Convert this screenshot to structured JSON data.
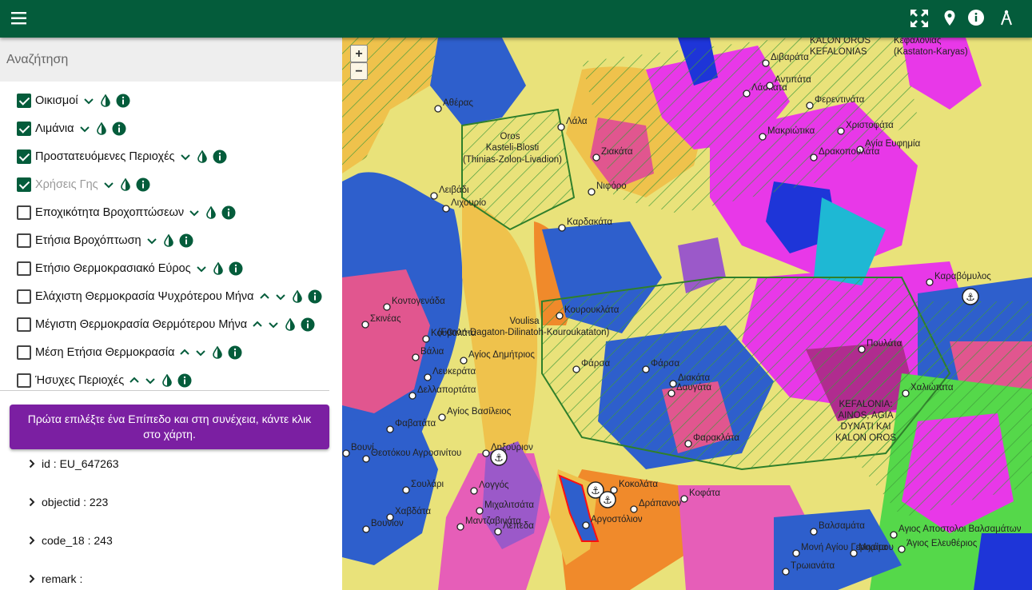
{
  "search": {
    "placeholder": "Αναζήτηση"
  },
  "layers": [
    {
      "label": "Οικισμοί",
      "checked": true,
      "chevrons": "down"
    },
    {
      "label": "Λιμάνια",
      "checked": true,
      "chevrons": "down"
    },
    {
      "label": "Προστατευόμενες Περιοχές",
      "checked": true,
      "chevrons": "down"
    },
    {
      "label": "Χρήσεις Γης",
      "checked": true,
      "chevrons": "down"
    },
    {
      "label": "Εποχικότητα Βροχοπτώσεων",
      "checked": false,
      "chevrons": "down"
    },
    {
      "label": "Ετήσια Βροχόπτωση",
      "checked": false,
      "chevrons": "down"
    },
    {
      "label": "Ετήσιο Θερμοκρασιακό Εύρος",
      "checked": false,
      "chevrons": "down"
    },
    {
      "label": "Ελάχιστη Θερμοκρασία Ψυχρότερου Μήνα",
      "checked": false,
      "chevrons": "updown"
    },
    {
      "label": "Μέγιστη Θερμοκρασία Θερμότερου Μήνα",
      "checked": false,
      "chevrons": "updown"
    },
    {
      "label": "Μέση Ετήσια Θερμοκρασία",
      "checked": false,
      "chevrons": "updown"
    },
    {
      "label": "Ήσυχες Περιοχές",
      "checked": false,
      "chevrons": "updown"
    }
  ],
  "banner": {
    "line1": "Πρώτα επιλέξτε ένα Επίπεδο και στη συνέχεια, κάντε κλικ",
    "line2": "στο χάρτη."
  },
  "attributes": [
    {
      "text": "id : EU_647263"
    },
    {
      "text": "objectid : 223"
    },
    {
      "text": "code_18 : 243"
    },
    {
      "text": "remark :"
    }
  ],
  "zoom": {
    "in": "+",
    "out": "−"
  },
  "map": {
    "towns": [
      "Διβαράτα",
      "Λάσκατα",
      "Αντιπάτα",
      "Φερεντινάτα",
      "Μακριώτικα",
      "Χριστοφάτα",
      "Αγία Ευφημία",
      "Δρακοπουλάτα",
      "Αθέρας",
      "Λάλα",
      "Ζιακάτα",
      "Νιφόρο",
      "Λειβάδι",
      "Λιχουρίο",
      "Καρδακάτα",
      "Κοντογενάδα",
      "Σκινέας",
      "Κουβαλάτα",
      "Βάλια",
      "Αγίος Δημήτριος",
      "Λευκεράτα",
      "Δελλαπορτάτα",
      "Αγίος Βασίλειος",
      "Φαβατάτα",
      "Κουρουκλάτα",
      "Φάρσα",
      "Διακάτα",
      "Δαυγάτα",
      "Πουλάτα",
      "Καραβόμυλος",
      "Χαλιώτατα",
      "Φαρακλάτα",
      "Κοφάτα",
      "Ληξούριον",
      "Λογγός",
      "Μιχαλιτσάτα",
      "Λέπεδα",
      "Αργοστόλιον",
      "Κοκολάτα",
      "Δράπανον",
      "Βαλσαμάτα",
      "Μαντζαβινάτα",
      "Σουλάρι",
      "Χαβδάτα",
      "Μονή Αγίου Γερασίμου",
      "Μιχάτα",
      "Αγιος Αποστολοι Βαλσαμάτων",
      "Άγιος Ελευθέριος",
      "Τρωιανάτα",
      "Βουνίον",
      "Θεοτόκου Αγροσινίτου",
      "Βουνί",
      "Φάρσα"
    ],
    "area_labels": {
      "north": [
        "KALON OROS",
        "KEFALONIAS"
      ],
      "north_paren": [
        "Κεφαλονιάς",
        "(Kastaton-Karyas)"
      ],
      "kastelli": [
        "Oros",
        "Kasteli-Blosti",
        "(Thinias-Zolon-Livadion)"
      ],
      "voulisa": [
        "Voulisa",
        "(Fonon-Dagaton-Dilinatoh-Kouroukataton)"
      ],
      "ainos": [
        "KEFALONIA:",
        "AINOS, AGIA",
        "DYNATI KAI",
        "KALON OROS"
      ]
    }
  },
  "colors": {
    "topbar": "#045c3b",
    "banner": "#7b1fa2",
    "checkbox": "#045c3b"
  }
}
